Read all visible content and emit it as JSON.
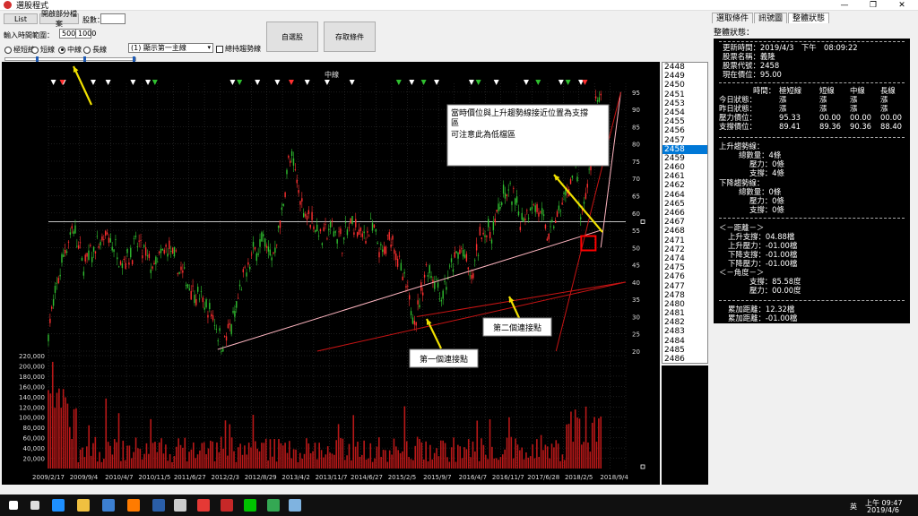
{
  "window": {
    "title": "選股程式",
    "icon": "app-logo-icon",
    "controls": [
      "—",
      "❐",
      "✕"
    ]
  },
  "toolbar": {
    "list_label": "List",
    "open_file_label": "開啟部分檔案",
    "stock_count_label": "股數：",
    "stock_count_value": "",
    "range_label": "輸入時間範圍：",
    "range_from": "500",
    "range_sep": "～",
    "range_to": "1000",
    "radios": [
      {
        "label": "極短線",
        "checked": false
      },
      {
        "label": "短線",
        "checked": false
      },
      {
        "label": "中線",
        "checked": true
      },
      {
        "label": "長線",
        "checked": false
      }
    ],
    "combo_value": "(1) 顯示第一主線",
    "combo_arrow": "▾",
    "checkbox_label": "總持趨勢線",
    "auto_select_label": "自選股",
    "save_condition_label": "存取條件"
  },
  "colors": {
    "chart_bg": "#000000",
    "candle_up": "#ff3030",
    "candle_down": "#30c030",
    "volume": "#b81818",
    "uptrend_line": "#ffb6c1",
    "downtrend_line": "#c81414",
    "highlight": "#ff0000",
    "annotation_arrow": "#f0e000",
    "list_selected": "#0078d7"
  },
  "chart_data": {
    "type": "candlestick",
    "title": "中線",
    "price_ylim": [
      20,
      96
    ],
    "price_ticks": [
      20,
      25,
      30,
      35,
      40,
      45,
      50,
      55,
      60,
      65,
      70,
      75,
      80,
      85,
      90,
      95
    ],
    "volume_ylim": [
      0,
      220000
    ],
    "volume_ticks": [
      "20,000",
      "40,000",
      "60,000",
      "80,000",
      "100,000",
      "120,000",
      "140,000",
      "160,000",
      "180,000",
      "200,000",
      "220,000"
    ],
    "x_ticks": [
      "2009/2/17",
      "2009/9/4",
      "2010/4/7",
      "2010/11/5",
      "2011/6/27",
      "2012/2/3",
      "2012/8/29",
      "2013/4/2",
      "2013/11/7",
      "2014/6/27",
      "2015/2/5",
      "2015/9/7",
      "2016/4/7",
      "2016/11/7",
      "2017/6/28",
      "2018/2/5",
      "2018/9/4"
    ],
    "support_level": 57.5,
    "price_path": [
      [
        0,
        26
      ],
      [
        3,
        48
      ],
      [
        5,
        56
      ],
      [
        7,
        45
      ],
      [
        9,
        49
      ],
      [
        12,
        53
      ],
      [
        15,
        46
      ],
      [
        18,
        51
      ],
      [
        21,
        44
      ],
      [
        24,
        50
      ],
      [
        27,
        42
      ],
      [
        30,
        36
      ],
      [
        33,
        30
      ],
      [
        35,
        22
      ],
      [
        37,
        28
      ],
      [
        39,
        40
      ],
      [
        41,
        48
      ],
      [
        43,
        52
      ],
      [
        45,
        47
      ],
      [
        47,
        60
      ],
      [
        48,
        74
      ],
      [
        49,
        75
      ],
      [
        51,
        62
      ],
      [
        53,
        58
      ],
      [
        55,
        53
      ],
      [
        57,
        56
      ],
      [
        59,
        52
      ],
      [
        61,
        57
      ],
      [
        63,
        53
      ],
      [
        65,
        56
      ],
      [
        67,
        47
      ],
      [
        69,
        54
      ],
      [
        71,
        42
      ],
      [
        73,
        32
      ],
      [
        74,
        30
      ],
      [
        76,
        45
      ],
      [
        78,
        40
      ],
      [
        79,
        36
      ],
      [
        81,
        44
      ],
      [
        83,
        50
      ],
      [
        85,
        40
      ],
      [
        87,
        55
      ],
      [
        89,
        54
      ],
      [
        91,
        64
      ],
      [
        93,
        66
      ],
      [
        95,
        58
      ],
      [
        97,
        63
      ],
      [
        99,
        60
      ],
      [
        100,
        53
      ],
      [
        102,
        58
      ],
      [
        104,
        65
      ],
      [
        106,
        74
      ],
      [
        107,
        56
      ],
      [
        109,
        75
      ],
      [
        110,
        93
      ],
      [
        111,
        95
      ]
    ],
    "uptrend_lines": [
      {
        "p1": [
          34,
          20.5
        ],
        "p2": [
          111,
          55
        ]
      },
      {
        "p1": [
          111,
          50
        ],
        "p2": [
          115,
          95
        ]
      }
    ],
    "downtrend_lines": [
      {
        "p1": [
          54,
          20
        ],
        "p2": [
          116,
          40
        ]
      },
      {
        "p1": [
          74,
          30
        ],
        "p2": [
          116,
          40
        ]
      },
      {
        "p1": [
          102,
          20
        ],
        "p2": [
          115,
          95
        ]
      }
    ],
    "touch_points": [
      [
        74,
        30
      ],
      [
        86,
        37
      ]
    ],
    "highlight_point": [
      108.5,
      51
    ],
    "markers_white": [
      1,
      3,
      9,
      12,
      17,
      20,
      37,
      42,
      46,
      52,
      56,
      61,
      73,
      78,
      85,
      90,
      96,
      103,
      107
    ],
    "markers_red": [
      2,
      48,
      107
    ],
    "markers_green": [
      21,
      38,
      70,
      75,
      86,
      98,
      104
    ],
    "annotations": {
      "callout_line1": "當時價位與上升趨勢線接近位置為支撐",
      "callout_line2": "區",
      "callout_line3": "可注意此為低檔區",
      "label_first": "第一個連接點",
      "label_second": "第二個連接點"
    }
  },
  "code_list": {
    "items": [
      "2448",
      "2449",
      "2450",
      "2451",
      "2453",
      "2454",
      "2455",
      "2456",
      "2457",
      "2458",
      "2459",
      "2460",
      "2461",
      "2462",
      "2464",
      "2465",
      "2466",
      "2467",
      "2468",
      "2471",
      "2472",
      "2474",
      "2475",
      "2476",
      "2477",
      "2478",
      "2480",
      "2481",
      "2482",
      "2483",
      "2484",
      "2485",
      "2486"
    ],
    "selected": "2458"
  },
  "right_panel": {
    "tabs": [
      {
        "label": "選取條件",
        "active": false
      },
      {
        "label": "訊號圖",
        "active": false
      },
      {
        "label": "整體狀態",
        "active": true
      }
    ],
    "title": "整體狀態：",
    "update_time": "更新時間：2019/4/3　下午　08:09:22",
    "stock_name": "股票名稱：義隆",
    "stock_code": "股票代號：2458",
    "current_price": "現在價位：95.00",
    "table_header": [
      "時間：",
      "極短線",
      "短線",
      "中線",
      "長線"
    ],
    "table_rows": [
      [
        "今日狀態：",
        "漲",
        "漲",
        "漲",
        "漲"
      ],
      [
        "昨日狀態：",
        "漲",
        "漲",
        "漲",
        "漲"
      ],
      [
        "壓力價位：",
        "95.33",
        "00.00",
        "00.00",
        "00.00"
      ],
      [
        "支撐價位：",
        "89.41",
        "89.36",
        "90.36",
        "88.40"
      ]
    ],
    "up_trend": "上升趨勢線：",
    "up_total": "總數量：4條",
    "up_pressure": "壓力：0條",
    "up_support": "支撐：4條",
    "down_trend": "下降趨勢線：",
    "down_total": "總數量：0條",
    "down_pressure": "壓力：0條",
    "down_support": "支撐：0條",
    "dist_title": "＜－距離－＞",
    "dist_up_support": "上升支撐：04.88檔",
    "dist_up_pressure": "上升壓力：-01.00檔",
    "dist_down_support": "下降支撐：-01.00檔",
    "dist_down_pressure": "下降壓力：-01.00檔",
    "angle_title": "＜－角度－＞",
    "angle_support": "支撐：85.58度",
    "angle_pressure": "壓力：00.00度",
    "total_dist": "累加距離：12.32檔",
    "total_dist2": "累加距離：-01.00檔"
  },
  "taskbar": {
    "clock_time": "上午 09:47",
    "clock_date": "2019/4/6",
    "ime": "英",
    "icons": [
      "windows-icon",
      "search-icon",
      "edge-icon",
      "explorer-icon",
      "store-icon",
      "firefox-icon",
      "b-app-icon",
      "mail-icon",
      "app-red-icon",
      "app-red2-icon",
      "line-icon",
      "chrome-icon",
      "photos-icon"
    ]
  }
}
